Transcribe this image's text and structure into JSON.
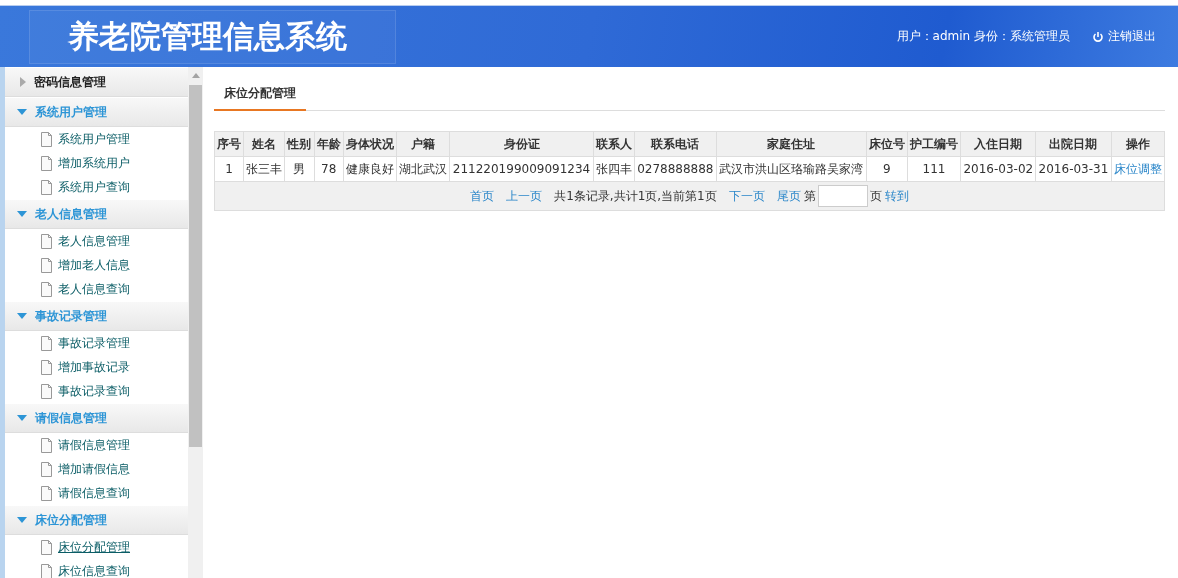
{
  "header": {
    "title": "养老院管理信息系统",
    "user_info": "用户：admin 身份：系统管理员",
    "logout": "注销退出"
  },
  "sidebar": {
    "groups": [
      {
        "label": "密码信息管理",
        "expanded": false
      },
      {
        "label": "系统用户管理",
        "expanded": true,
        "items": [
          {
            "label": "系统用户管理",
            "selected": false
          },
          {
            "label": "增加系统用户",
            "selected": false
          },
          {
            "label": "系统用户查询",
            "selected": false
          }
        ]
      },
      {
        "label": "老人信息管理",
        "expanded": true,
        "items": [
          {
            "label": "老人信息管理",
            "selected": false
          },
          {
            "label": "增加老人信息",
            "selected": false
          },
          {
            "label": "老人信息查询",
            "selected": false
          }
        ]
      },
      {
        "label": "事故记录管理",
        "expanded": true,
        "items": [
          {
            "label": "事故记录管理",
            "selected": false
          },
          {
            "label": "增加事故记录",
            "selected": false
          },
          {
            "label": "事故记录查询",
            "selected": false
          }
        ]
      },
      {
        "label": "请假信息管理",
        "expanded": true,
        "items": [
          {
            "label": "请假信息管理",
            "selected": false
          },
          {
            "label": "增加请假信息",
            "selected": false
          },
          {
            "label": "请假信息查询",
            "selected": false
          }
        ]
      },
      {
        "label": "床位分配管理",
        "expanded": true,
        "items": [
          {
            "label": "床位分配管理",
            "selected": true
          },
          {
            "label": "床位信息查询",
            "selected": false
          }
        ]
      }
    ]
  },
  "tabs": [
    {
      "label": "床位分配管理",
      "selected": true
    }
  ],
  "table": {
    "columns": [
      "序号",
      "姓名",
      "性别",
      "年龄",
      "身体状况",
      "户籍",
      "身份证",
      "联系人",
      "联系电话",
      "家庭住址",
      "床位号",
      "护工编号",
      "入住日期",
      "出院日期",
      "操作"
    ],
    "rows": [
      {
        "cells": [
          "1",
          "张三丰",
          "男",
          "78",
          "健康良好",
          "湖北武汉",
          "211220199009091234",
          "张四丰",
          "0278888888",
          "武汉市洪山区珞瑜路吴家湾",
          "9",
          "111",
          "2016-03-02",
          "2016-03-31"
        ],
        "action": "床位调整"
      }
    ]
  },
  "pagination": {
    "first": "首页",
    "prev": "上一页",
    "summary": "共1条记录,共计1页,当前第1页",
    "next": "下一页",
    "last": "尾页",
    "page_prefix": "第",
    "page_suffix": "页",
    "go": "转到"
  }
}
